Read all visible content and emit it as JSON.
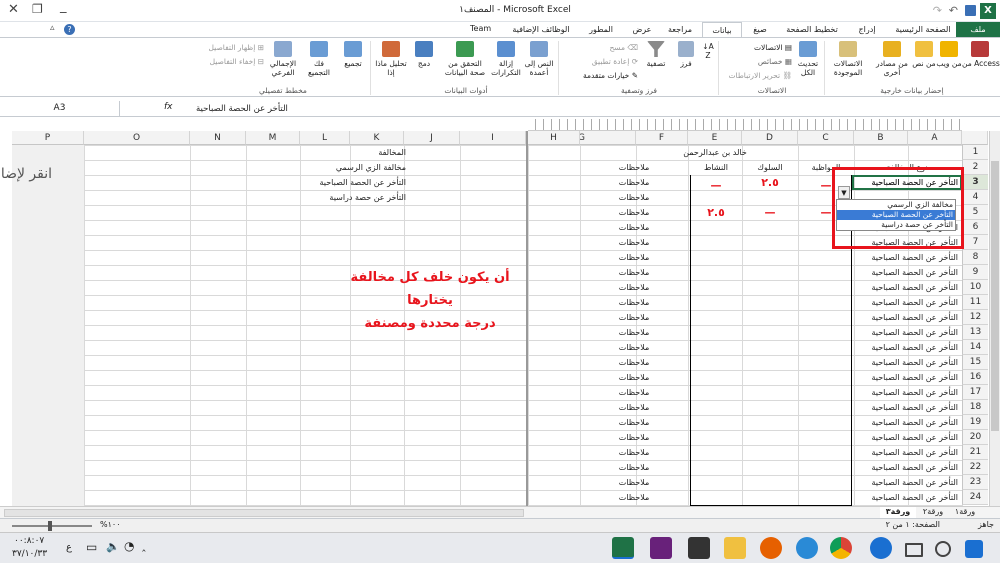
{
  "window": {
    "title": "المصنف١ - Microsoft Excel",
    "team": "Team"
  },
  "tabs": [
    "ملف",
    "الصفحة الرئيسية",
    "إدراج",
    "تخطيط الصفحة",
    "صيغ",
    "بيانات",
    "مراجعة",
    "عرض",
    "المطور",
    "الوظائف الإضافية"
  ],
  "ribbon": {
    "access": "من Access",
    "web": "من ويب",
    "text": "من نص",
    "other": "من مصادر أخرى",
    "existing": "الاتصالات الموجودة",
    "refresh": "تحديث الكل",
    "conn": "الاتصالات",
    "props": "خصائص",
    "links": "تحرير الارتباطات",
    "sort": "فرز",
    "filter": "تصفية",
    "clear": "مسح",
    "reapply": "إعادة تطبيق",
    "advanced": "خيارات متقدمة",
    "text_cols": "النص إلى أعمدة",
    "remove_dup": "إزالة التكرارات",
    "validation": "التحقق من صحة البيانات",
    "consolidate": "دمج",
    "whatif": "تحليل ماذا إذا",
    "group": "تجميع",
    "ungroup": "فك التجميع",
    "subtotal": "الإجمالي الفرعي",
    "show_detail": "إظهار التفاصيل",
    "hide_detail": "إخفاء التفاصيل",
    "g_external": "إحضار بيانات خارجية",
    "g_connections": "الاتصالات",
    "g_sort": "فرز وتصفية",
    "g_tools": "أدوات البيانات",
    "g_outline": "مخطط تفصيلي"
  },
  "namebox": "A3",
  "fx": "fx",
  "formula": "التأخر عن الحصة الصباحية",
  "columns_right": [
    "A",
    "B",
    "C",
    "D",
    "E",
    "F",
    "G",
    "H"
  ],
  "columns_left": [
    "I",
    "J",
    "K",
    "L",
    "M",
    "N",
    "O",
    "P"
  ],
  "rows": [
    "1",
    "2",
    "3",
    "4",
    "5",
    "6",
    "7",
    "8",
    "9",
    "10",
    "11",
    "12",
    "13",
    "14",
    "15",
    "16",
    "17",
    "18",
    "19",
    "20",
    "21",
    "22",
    "23",
    "24"
  ],
  "sheet": {
    "name": "خالد بن عبدالرحمن",
    "h_type": "نوع المخالفة",
    "h_attend": "المواظبة",
    "h_behave": "السلوك",
    "h_activity": "النشاط",
    "h_notes": "ملاحظات",
    "type_value": "التأخر عن الحصة الصباحية",
    "note_value": "ملاحظات",
    "d3": "٢.٥",
    "e4": "٢.٥",
    "dash": "—"
  },
  "dropdown": [
    "مخالفة الزي الرسمي",
    "التأخر عن الحصة الصباحية",
    "التأخر عن حصة دراسية"
  ],
  "list": {
    "header": "المخالفة",
    "items": [
      "مخالفة الزي الرسمي",
      "التأخر عن الحصة الصباحية",
      "التأخر عن حصة دراسية"
    ]
  },
  "note": {
    "l1": "أن يكون خلف كل مخالفة",
    "l2": "يختارها",
    "l3": "درجة محددة ومصنفة"
  },
  "side_text": "انقر لإضا",
  "sheet_tabs": [
    "ورقة٣",
    "ورقة٢",
    "ورقة١"
  ],
  "status": {
    "mode": "جاهز",
    "page": "الصفحة: ١ من ٢",
    "zoom": "%١٠٠"
  },
  "clock": {
    "time": "٠٠:٨:٠٧",
    "date": "٣٧/١٠/٣٣",
    "lang": "ع"
  },
  "colors": {
    "accent": "#1f7246",
    "red": "#e8141c",
    "selected": "#3a7bd5"
  }
}
